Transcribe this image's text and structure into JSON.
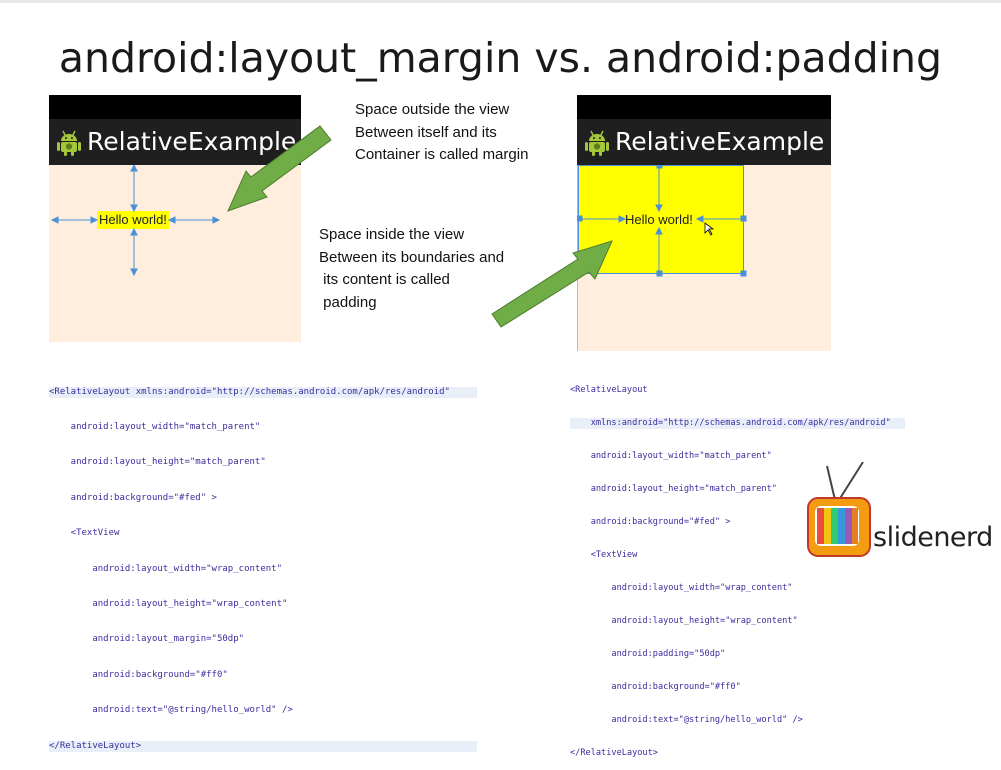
{
  "title": "android:layout_margin vs. android:padding",
  "left_phone": {
    "app_title": "RelativeExample",
    "text_view": "Hello world!"
  },
  "right_phone": {
    "app_title": "RelativeExample",
    "text_view": "Hello world!"
  },
  "notes": {
    "margin": "Space outside the view\nBetween itself and its\nContainer is called margin",
    "padding": "Space inside the view\nBetween its boundaries and\n its content is called\n padding"
  },
  "code_left": [
    "<RelativeLayout xmlns:android=\"http://schemas.android.com/apk/res/android\"",
    "    android:layout_width=\"match_parent\"",
    "    android:layout_height=\"match_parent\"",
    "    android:background=\"#fed\" >",
    "    <TextView",
    "        android:layout_width=\"wrap_content\"",
    "        android:layout_height=\"wrap_content\"",
    "        android:layout_margin=\"50dp\"",
    "        android:background=\"#ff0\"",
    "        android:text=\"@string/hello_world\" />",
    "</RelativeLayout>"
  ],
  "code_right": [
    "<RelativeLayout",
    "    xmlns:android=\"http://schemas.android.com/apk/res/android\"",
    "    android:layout_width=\"match_parent\"",
    "    android:layout_height=\"match_parent\"",
    "    android:background=\"#fed\" >",
    "    <TextView",
    "        android:layout_width=\"wrap_content\"",
    "        android:layout_height=\"wrap_content\"",
    "        android:padding=\"50dp\"",
    "        android:background=\"#ff0\"",
    "        android:text=\"@string/hello_world\" />",
    "</RelativeLayout>"
  ],
  "brand": "slidenerd",
  "colors": {
    "container_bg": "#ffeedd",
    "textview_bg": "#ffff00",
    "arrow": "#70ad47",
    "selection": "#4a90d9"
  }
}
